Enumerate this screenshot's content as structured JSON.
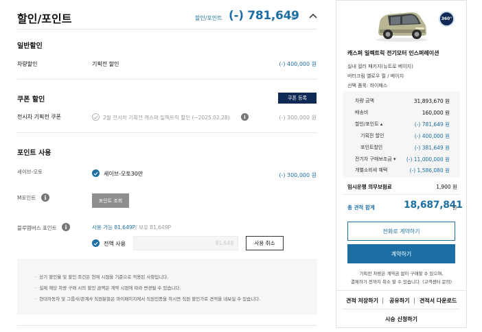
{
  "header": {
    "title": "할인/포인트",
    "total_label": "할인/포인트",
    "total_value": "(-) 781,649",
    "total_unit": "원"
  },
  "general_discount": {
    "title": "일반할인",
    "row_label": "차량할인",
    "row_name": "기획전 할인",
    "row_amount": "(-) 400,000 원"
  },
  "coupon": {
    "title": "쿠폰 할인",
    "register_label": "쿠폰 등록",
    "row_label": "전시차 기획전 쿠폰",
    "row_text": "2월 전시차 기획전 캐스퍼 일렉트릭 할인 (~2025.02.28)",
    "row_amount": "(-) 300,000 원"
  },
  "points": {
    "title": "포인트 사용",
    "save_auto_label": "세이브-오토",
    "save_auto_option": "세이브-오토30만",
    "save_auto_amount": "(-) 300,000 원",
    "m_point_label": "M포인트",
    "m_point_button": "포인트 조회",
    "blue_members_label": "블루멤버스 포인트",
    "available_label": "사용 가능 81,649P",
    "held_label": "/ 보유 81,649P",
    "use_all_label": "전액 사용",
    "input_value": "81,649",
    "cancel_label": "사용 취소"
  },
  "notices": [
    "상기 할인율 및 할인 조건은 현재 시점을 기준으로 적용된 사항입니다.",
    "실제 해당 차량 구매 시의 할인 금액은 계약 시점에 따라 변경될 수 있습니다.",
    "현대자동차 및 그룹사/관계사 직원분들은 마이페이지에서 직원인증을 하시면 직원 할인가로 견적을 내보실 수 있습니다."
  ],
  "summary": {
    "badge_360": "360°",
    "car_name": "캐스퍼 일렉트릭 전기모터 인스퍼레이션",
    "specs": [
      "실내 컬러 패키지(뉴트로 베이지)",
      "버터크림 옐로우 펄 / 베이지",
      "선택 품목: 하이패스"
    ],
    "prices": [
      {
        "label": "차량 금액",
        "value": "31,893,670 원"
      },
      {
        "label": "배송비",
        "value": "160,000 원"
      },
      {
        "label": "할인/포인트 ▴",
        "value": "(-) 781,649 원"
      },
      {
        "label": "기획전 할인",
        "value": "(-) 400,000 원"
      },
      {
        "label": "포인트할인",
        "value": "(-) 381,649 원"
      },
      {
        "label": "전기차 구매보조금 ▾",
        "value": "(-) 11,000,000 원"
      },
      {
        "label": "개별소비세 혜택",
        "value": "(-) 1,586,080 원"
      }
    ],
    "registration_label": "임시운행 의무보험료",
    "registration_value": "1,900 원",
    "estimate_label": "총 견적 합계",
    "estimate_value": "18,687,841",
    "estimate_unit": "원",
    "phone_contract_label": "전화로 계약하기",
    "contract_label": "계약하기",
    "contract_note_1": "기획전 차량은 계약금 없이 구매할 수 있으며,",
    "contract_note_2": "결제하기 전까지 취소 할 수 있습니다. (고객센터 문의)",
    "links": [
      "견적 저장하기",
      "공유하기",
      "견적서 다운로드"
    ],
    "test_drive_label": "시승 신청하기"
  },
  "colors": {
    "accent_blue": "#1d6fa3",
    "navy": "#0e2a55"
  }
}
